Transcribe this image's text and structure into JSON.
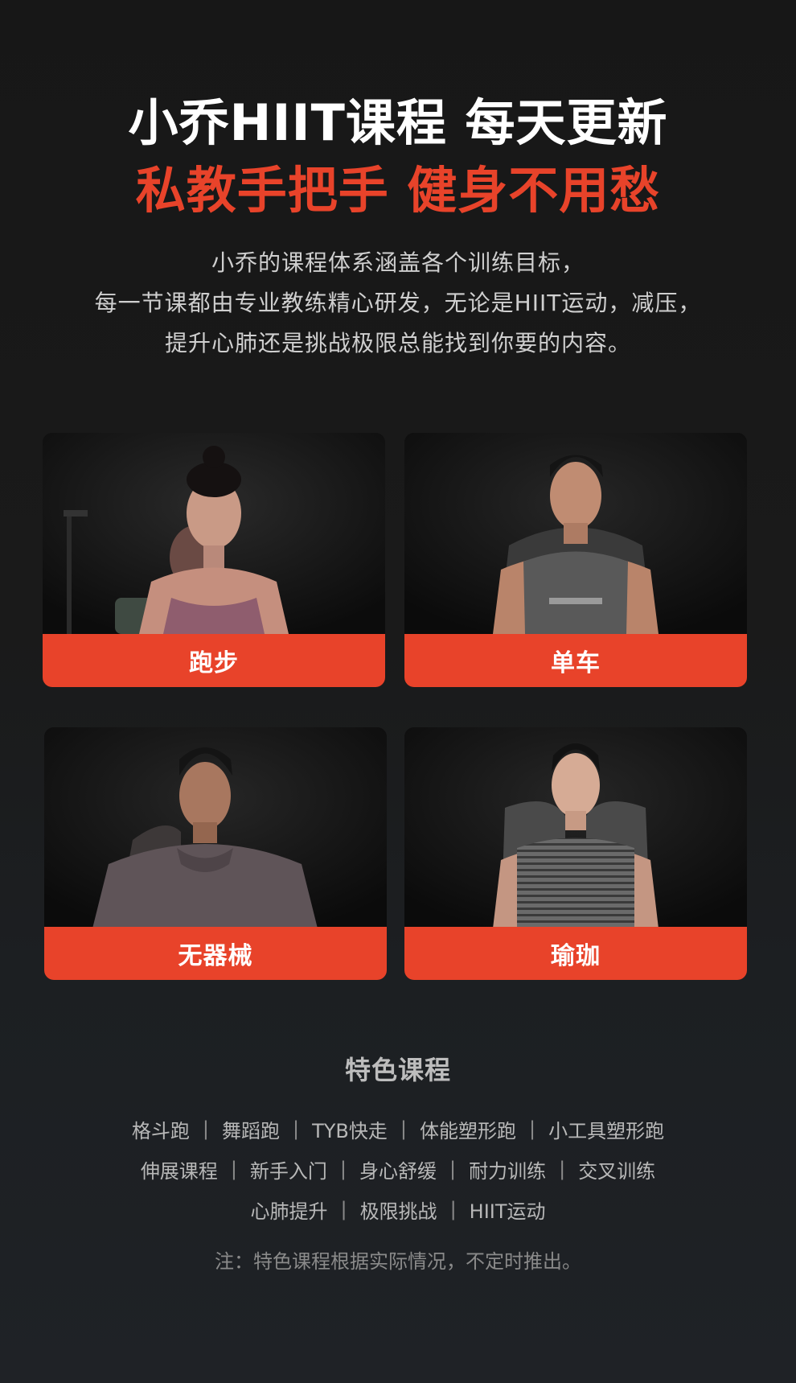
{
  "colors": {
    "accent": "#e8432a",
    "background": "#181818"
  },
  "hero": {
    "title_line1": "小乔HIIT课程  每天更新",
    "title_line2": "私教手把手  健身不用愁",
    "intro_lines": [
      "小乔的课程体系涵盖各个训练目标，",
      "每一节课都由专业教练精心研发，无论是HIIT运动，减压，",
      "提升心肺还是挑战极限总能找到你要的内容。"
    ]
  },
  "categories": [
    {
      "label": "跑步"
    },
    {
      "label": "单车"
    },
    {
      "label": "无器械"
    },
    {
      "label": "瑜珈"
    }
  ],
  "featured": {
    "title": "特色课程",
    "tag_rows": [
      [
        "格斗跑",
        "舞蹈跑",
        "TYB快走",
        "体能塑形跑",
        "小工具塑形跑"
      ],
      [
        "伸展课程",
        "新手入门",
        "身心舒缓",
        "耐力训练",
        "交叉训练"
      ],
      [
        "心肺提升",
        "极限挑战",
        "HIIT运动"
      ]
    ],
    "separator": "|",
    "note": "注：特色课程根据实际情况，不定时推出。"
  }
}
